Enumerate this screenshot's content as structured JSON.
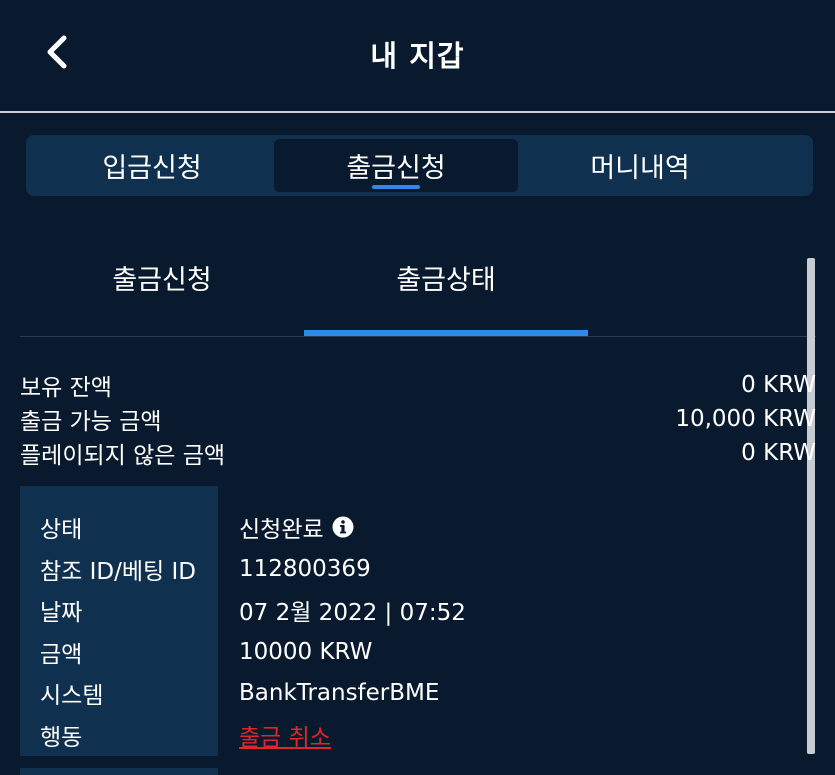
{
  "header": {
    "title": "내 지갑"
  },
  "tabs": [
    {
      "label": "입금신청",
      "active": false
    },
    {
      "label": "출금신청",
      "active": true
    },
    {
      "label": "머니내역",
      "active": false
    }
  ],
  "subtabs": [
    {
      "label": "출금신청",
      "active": false
    },
    {
      "label": "출금상태",
      "active": true
    }
  ],
  "balances": [
    {
      "label": "보유 잔액",
      "value": "0 KRW"
    },
    {
      "label": "출금 가능 금액",
      "value": "10,000 KRW"
    },
    {
      "label": "플레이되지 않은 금액",
      "value": "0 KRW"
    }
  ],
  "details": {
    "status": {
      "label": "상태",
      "value": "신청완료"
    },
    "ref": {
      "label": "참조 ID/베팅 ID",
      "value": "112800369"
    },
    "date": {
      "label": "날짜",
      "value": "07 2월 2022 | 07:52"
    },
    "amount": {
      "label": "금액",
      "value": "10000 KRW"
    },
    "system": {
      "label": "시스템",
      "value": "BankTransferBME"
    },
    "action": {
      "label": "행동",
      "value": "출금 취소"
    }
  },
  "colors": {
    "background": "#0a1a2e",
    "panel": "#10304f",
    "accent": "#2f8ae5",
    "danger": "#e0262a"
  },
  "icons": {
    "back": "chevron-left-icon",
    "info": "info-circle-icon"
  }
}
